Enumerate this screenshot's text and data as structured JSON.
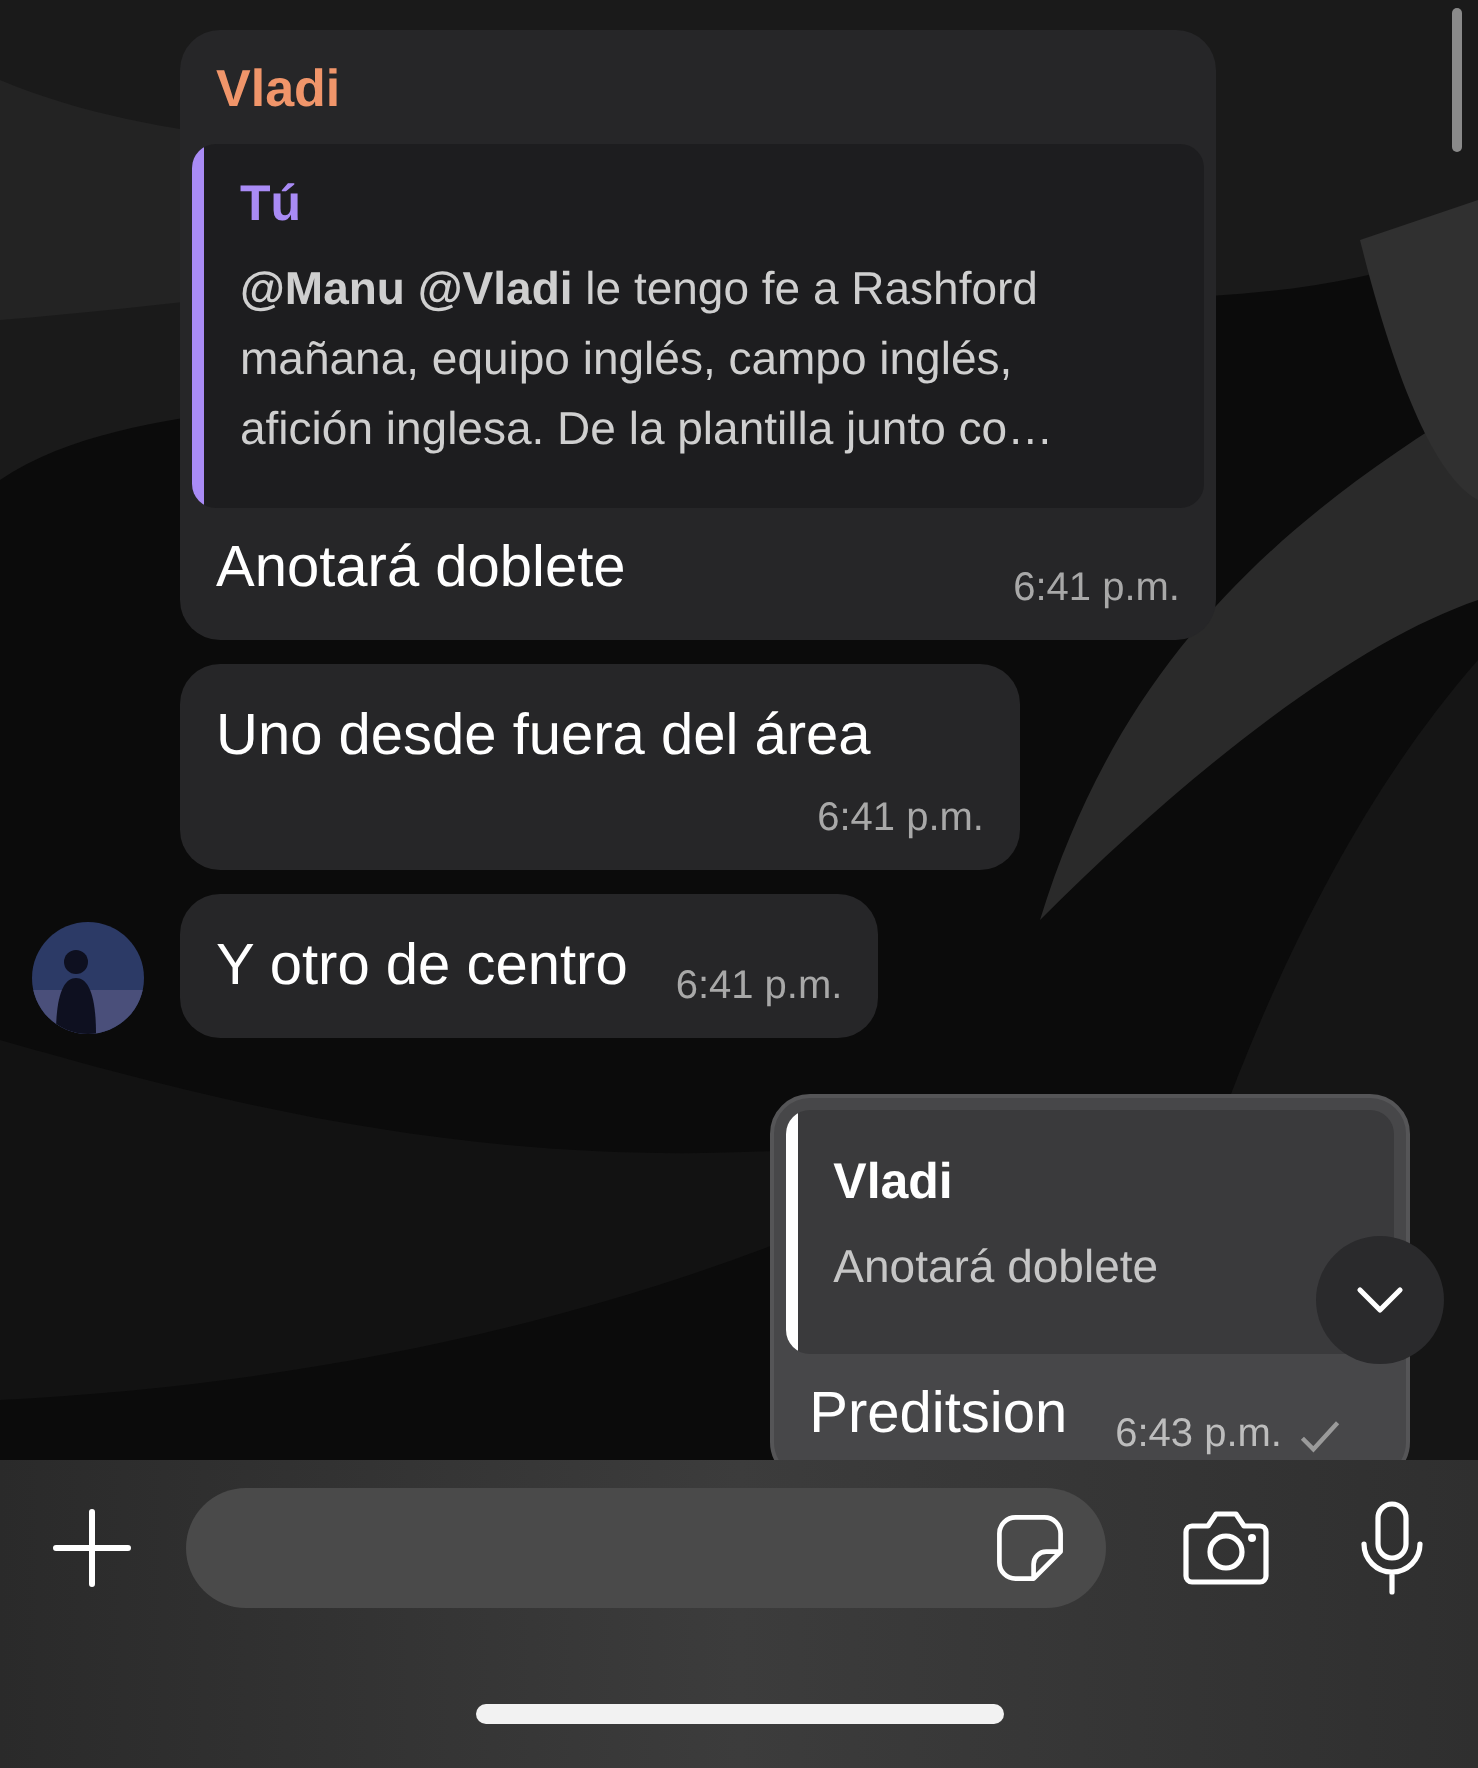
{
  "messages": [
    {
      "kind": "incoming",
      "sender": {
        "name": "Vladi",
        "color": "#f0956a"
      },
      "avatar": false,
      "quote": {
        "author": "Tú",
        "color": "#a98bf5",
        "text": "**@Manu** **@Vladi** le tengo fe a Rashford mañana, equipo inglés, campo inglés, afición inglesa. De la plantilla junto co…"
      },
      "text": "Anotará doblete",
      "time": "6:41 p.m."
    },
    {
      "kind": "incoming",
      "avatar": false,
      "text": "Uno desde fuera del área",
      "time": "6:41 p.m."
    },
    {
      "kind": "incoming",
      "avatar": true,
      "text": "Y otro de centro",
      "time": "6:41 p.m."
    },
    {
      "kind": "outgoing",
      "quote": {
        "author": "Vladi",
        "color": "#ffffff",
        "text": "Anotará doblete"
      },
      "text": "Preditsion",
      "time": "6:43 p.m.",
      "read": false
    }
  ]
}
